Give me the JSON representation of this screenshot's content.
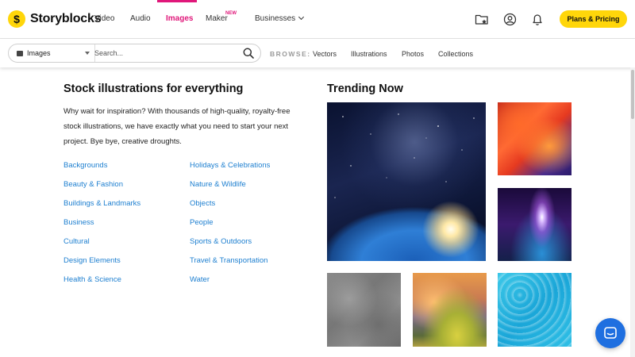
{
  "brand": {
    "name": "Storyblocks",
    "logo_glyph": "$",
    "accent": "#e0177a",
    "cta_color": "#ffd60a",
    "link_color": "#1d7fd0"
  },
  "nav": {
    "items": [
      {
        "label": "Video"
      },
      {
        "label": "Audio"
      },
      {
        "label": "Images",
        "active": true
      },
      {
        "label": "Maker",
        "badge": "NEW"
      },
      {
        "label": "Businesses",
        "has_dropdown": true
      }
    ],
    "icons": [
      "folder-star-icon",
      "user-icon",
      "bell-icon"
    ],
    "cta_label": "Plans & Pricing"
  },
  "search": {
    "type_value": "Images",
    "placeholder": "Search...",
    "browse_label": "BROWSE:",
    "browse_links": [
      "Vectors",
      "Illustrations",
      "Photos",
      "Collections"
    ]
  },
  "main": {
    "title": "Stock illustrations for everything",
    "intro": "Why wait for inspiration? With thousands of high-quality, royalty-free stock illustrations, we have exactly what you need to start your next project. Bye bye, creative droughts.",
    "categories_left": [
      "Backgrounds",
      "Beauty & Fashion",
      "Buildings & Landmarks",
      "Business",
      "Cultural",
      "Design Elements",
      "Health & Science"
    ],
    "categories_right": [
      "Holidays & Celebrations",
      "Nature & Wildlife",
      "Objects",
      "People",
      "Sports & Outdoors",
      "Travel & Transportation",
      "Water"
    ]
  },
  "trending": {
    "title": "Trending Now",
    "thumbnails": [
      "space-earth-image",
      "fire-swirl-image",
      "purple-aurora-image",
      "concrete-texture-image",
      "painted-landscape-image",
      "water-pattern-image"
    ]
  }
}
